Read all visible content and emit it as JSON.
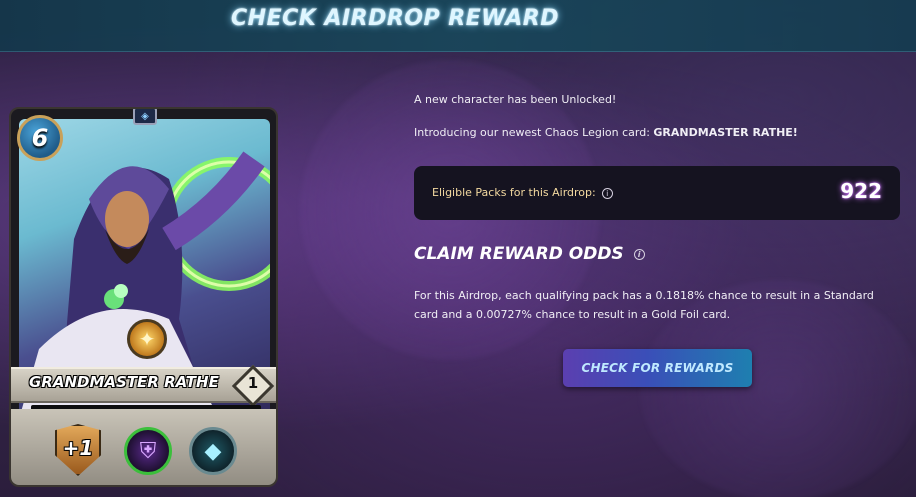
{
  "header": {
    "title": "CHECK AIRDROP REWARD"
  },
  "card": {
    "mana": "6",
    "name": "GRANDMASTER RATHE",
    "level": "1",
    "shield_stat": "+1",
    "abilities": [
      "shield-ability-icon",
      "reflect-ability-icon"
    ]
  },
  "intro": {
    "line1": "A new character has been Unlocked!",
    "line2_prefix": "Introducing our newest Chaos Legion card: ",
    "line2_name": "GRANDMASTER RATHE!"
  },
  "packs": {
    "label": "Eligible Packs for this Airdrop:",
    "value": "922"
  },
  "odds": {
    "title": "CLAIM REWARD ODDS",
    "text": "For this Airdrop, each qualifying pack has a 0.1818% chance to result in a Standard card and a 0.00727% chance to result in a Gold Foil card."
  },
  "buttons": {
    "check_rewards": "CHECK FOR REWARDS"
  },
  "colors": {
    "header_bg": "#19465a",
    "accent_glow": "#c86bff",
    "button_start": "#5b3fb0",
    "button_end": "#1e7fb0"
  }
}
